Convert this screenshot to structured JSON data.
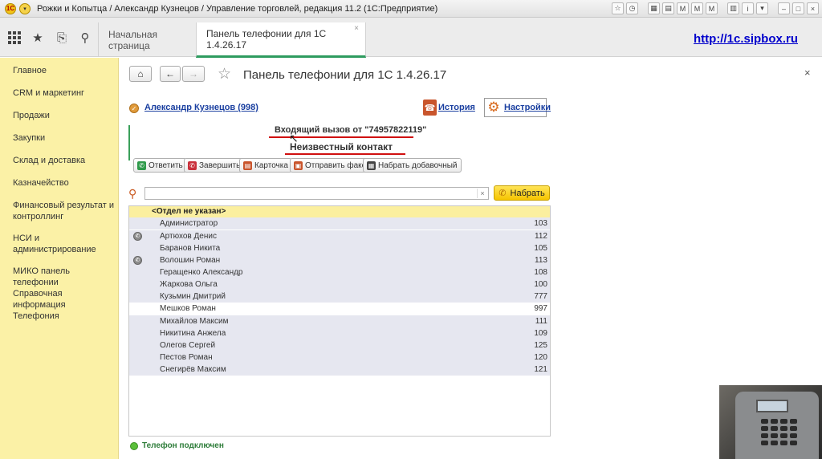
{
  "window": {
    "title": "Рожки и Копытца / Александр Кузнецов / Управление торговлей, редакция 11.2  (1С:Предприятие)"
  },
  "topnav": {
    "tabs": [
      {
        "label": "Начальная страница"
      },
      {
        "label": "Панель телефонии для 1С 1.4.26.17"
      }
    ],
    "tab_close": "×",
    "site_link": "http://1c.sipbox.ru"
  },
  "sidebar": {
    "items": [
      {
        "label": "Главное"
      },
      {
        "label": "CRM и маркетинг"
      },
      {
        "label": "Продажи"
      },
      {
        "label": "Закупки"
      },
      {
        "label": "Склад и доставка"
      },
      {
        "label": "Казначейство"
      },
      {
        "label": "Финансовый результат и контроллинг"
      },
      {
        "label": "НСИ и администрирование"
      },
      {
        "label": "МИКО панель телефонии"
      },
      {
        "label": "Справочная информация"
      },
      {
        "label": "Телефония"
      }
    ]
  },
  "page": {
    "title": "Панель телефонии для 1С 1.4.26.17",
    "close": "×"
  },
  "agent": {
    "name": "Александр Кузнецов (998)",
    "history_label": "История",
    "settings_label": "Настройки"
  },
  "call": {
    "incoming": "Входящий вызов от \"74957822119\"",
    "contact": "Неизвестный контакт",
    "actions": [
      {
        "label": "Ответить",
        "icon": "phone-answer-icon",
        "color": "#2f9a4b"
      },
      {
        "label": "Завершить",
        "icon": "phone-hangup-icon",
        "color": "#c9303b"
      },
      {
        "label": "Карточка",
        "icon": "card-icon",
        "color": "#c9552c"
      },
      {
        "label": "Отправить факс",
        "icon": "fax-icon",
        "color": "#c9552c"
      },
      {
        "label": "Набрать добавочный",
        "icon": "keypad-icon",
        "color": "#444444"
      }
    ]
  },
  "search": {
    "value": "",
    "clear": "×",
    "dial_label": "Набрать"
  },
  "contacts": {
    "department": "<Отдел не указан>",
    "rows": [
      {
        "name": "Администратор",
        "ext": "103",
        "status": false
      },
      {
        "name": "Артюхов Денис",
        "ext": "112",
        "status": true
      },
      {
        "name": "Баранов Никита",
        "ext": "105",
        "status": false
      },
      {
        "name": "Волошин Роман",
        "ext": "113",
        "status": true
      },
      {
        "name": "Геращенко Александр",
        "ext": "108",
        "status": false
      },
      {
        "name": "Жаркова Ольга",
        "ext": "100",
        "status": false
      },
      {
        "name": "Кузьмин Дмитрий",
        "ext": "777",
        "status": false
      },
      {
        "name": "Мешков Роман",
        "ext": "997",
        "status": false,
        "selected": true
      },
      {
        "name": "Михайлов Максим",
        "ext": "111",
        "status": false
      },
      {
        "name": "Никитина Анжела",
        "ext": "109",
        "status": false
      },
      {
        "name": "Олегов Сергей",
        "ext": "125",
        "status": false
      },
      {
        "name": "Пестов Роман",
        "ext": "120",
        "status": false
      },
      {
        "name": "Снегирёв Максим",
        "ext": "121",
        "status": false
      }
    ]
  },
  "status": {
    "text": "Телефон подключен",
    "color": "#5bbf3a"
  }
}
